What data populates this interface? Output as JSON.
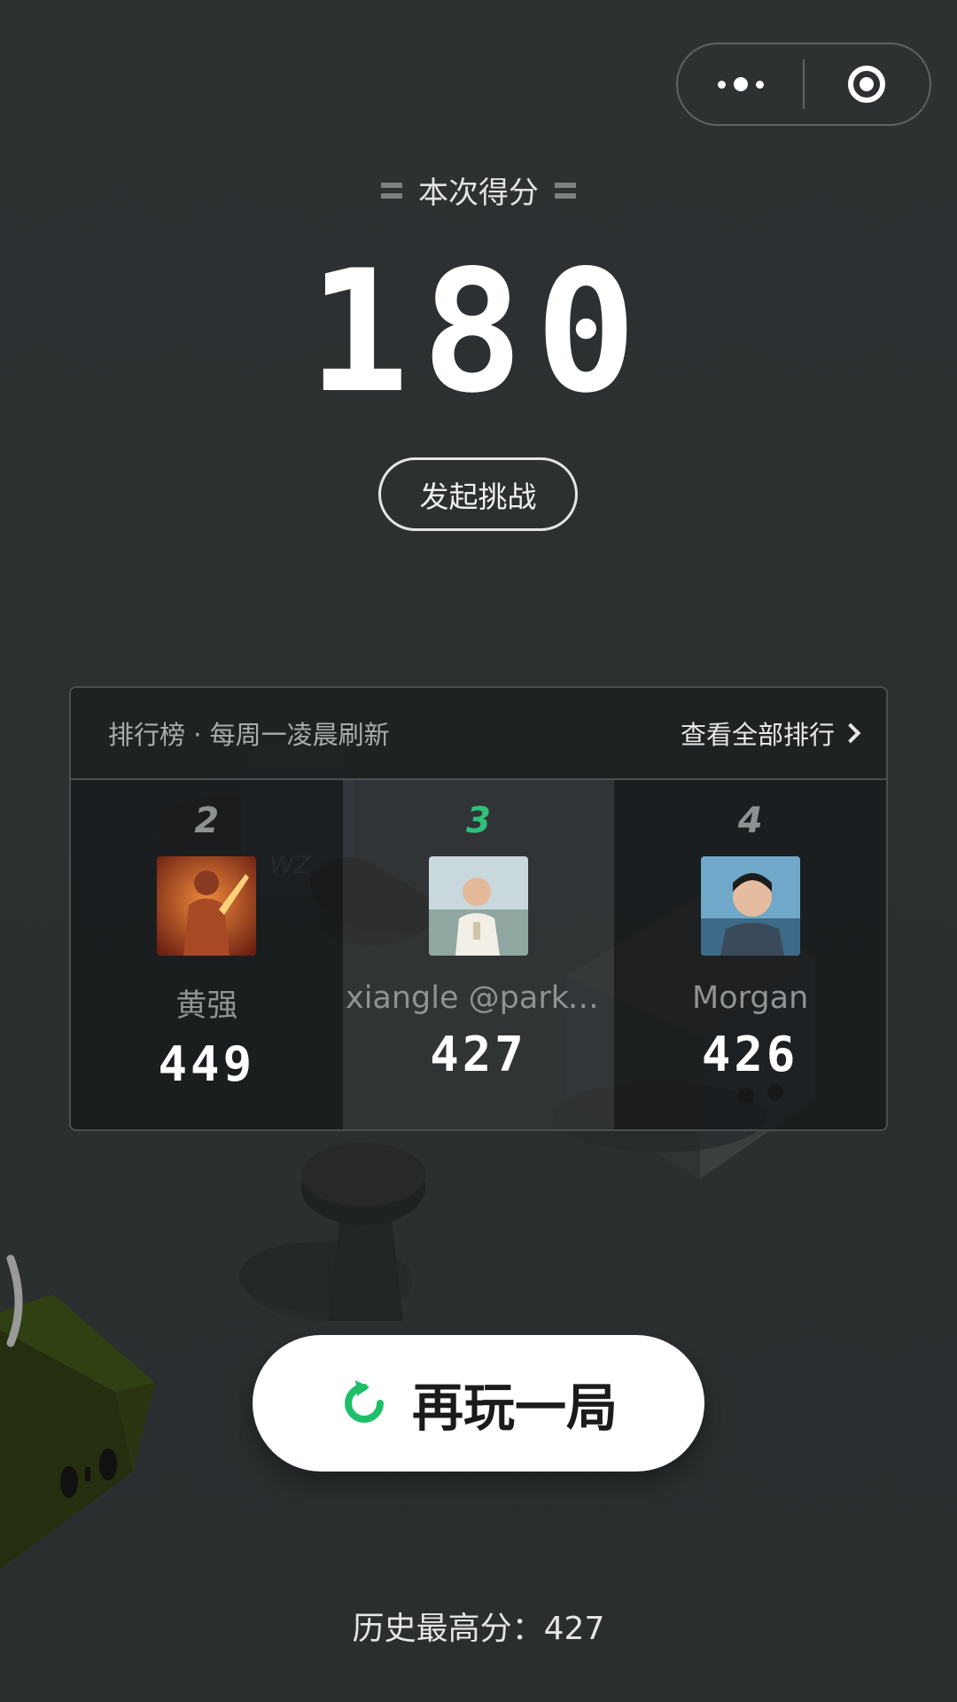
{
  "capsule": {
    "more_icon": "more-dots-icon",
    "close_icon": "target-close-icon"
  },
  "score": {
    "title": "本次得分",
    "value": "180"
  },
  "challenge_button": "发起挑战",
  "leaderboard": {
    "title": "排行榜 · 每周一凌晨刷新",
    "view_all": "查看全部排行",
    "entries": [
      {
        "rank": "2",
        "name": "黄强",
        "score": "449",
        "highlight": false
      },
      {
        "rank": "3",
        "name": "xiangle @parko...",
        "score": "427",
        "highlight": true
      },
      {
        "rank": "4",
        "name": "Morgan",
        "score": "426",
        "highlight": false
      }
    ]
  },
  "replay_button": "再玩一局",
  "best_score": "历史最高分：427",
  "colors": {
    "background": "#2b2f30",
    "accent_green": "#2fc07a",
    "rank_gray": "#8d9192"
  }
}
